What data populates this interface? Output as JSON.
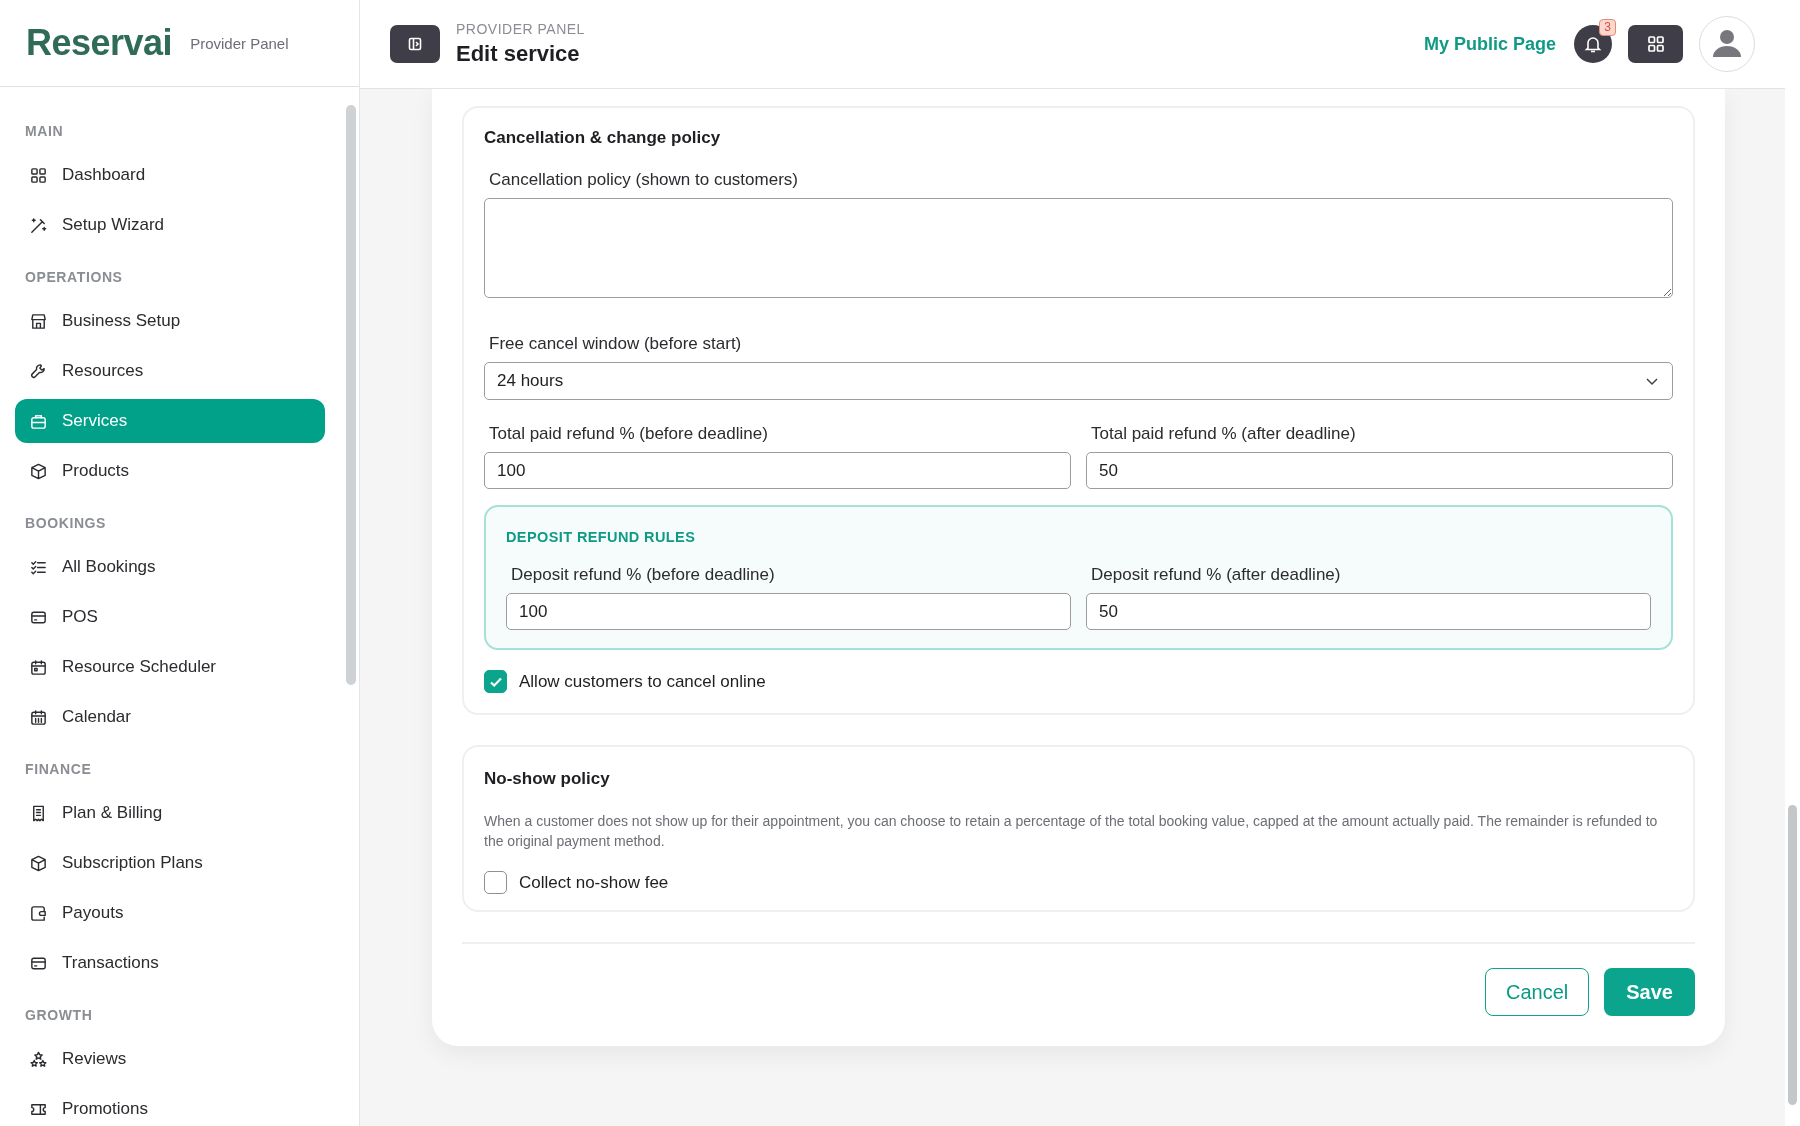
{
  "sidebar": {
    "brand": "Reservai",
    "brand_subtitle": "Provider Panel",
    "sections": [
      {
        "label": "MAIN",
        "items": [
          {
            "label": "Dashboard",
            "selected": false
          },
          {
            "label": "Setup Wizard",
            "selected": false
          }
        ]
      },
      {
        "label": "OPERATIONS",
        "items": [
          {
            "label": "Business Setup",
            "selected": false
          },
          {
            "label": "Resources",
            "selected": false
          },
          {
            "label": "Services",
            "selected": true
          },
          {
            "label": "Products",
            "selected": false
          }
        ]
      },
      {
        "label": "BOOKINGS",
        "items": [
          {
            "label": "All Bookings",
            "selected": false
          },
          {
            "label": "POS",
            "selected": false
          },
          {
            "label": "Resource Scheduler",
            "selected": false
          },
          {
            "label": "Calendar",
            "selected": false
          }
        ]
      },
      {
        "label": "FINANCE",
        "items": [
          {
            "label": "Plan & Billing",
            "selected": false
          },
          {
            "label": "Subscription Plans",
            "selected": false
          },
          {
            "label": "Payouts",
            "selected": false
          },
          {
            "label": "Transactions",
            "selected": false
          }
        ]
      },
      {
        "label": "GROWTH",
        "items": [
          {
            "label": "Reviews",
            "selected": false
          },
          {
            "label": "Promotions",
            "selected": false
          }
        ]
      }
    ]
  },
  "header": {
    "eyebrow": "PROVIDER PANEL",
    "title": "Edit service",
    "public_link": "My Public Page",
    "notification_count": "3"
  },
  "cancellation": {
    "title": "Cancellation & change policy",
    "policy_label": "Cancellation policy (shown to customers)",
    "window_label": "Free cancel window (before start)",
    "window_value": "24 hours",
    "refund_before_label": "Total paid refund % (before deadline)",
    "refund_before": "100",
    "refund_after_label": "Total paid refund % (after deadline)",
    "refund_after": "50",
    "deposit": {
      "title": "DEPOSIT REFUND RULES",
      "before_label": "Deposit refund % (before deadline)",
      "before": "100",
      "after_label": "Deposit refund % (after deadline)",
      "after": "50"
    },
    "allow_online": {
      "label": "Allow customers to cancel online",
      "checked": true
    }
  },
  "no_show": {
    "title": "No-show policy",
    "description": "When a customer does not show up for their appointment, you can choose to retain a percentage of the total booking value, capped at the amount actually paid. The remainder is refunded to the original payment method.",
    "collect_fee": {
      "label": "Collect no-show fee",
      "checked": false
    }
  },
  "actions": {
    "cancel": "Cancel",
    "save": "Save"
  }
}
